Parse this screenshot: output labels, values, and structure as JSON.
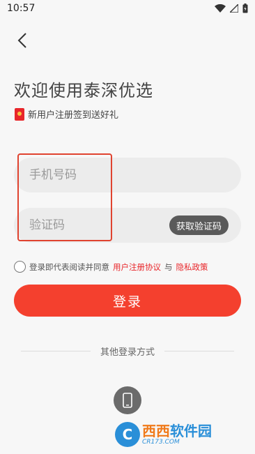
{
  "status_bar": {
    "time": "10:57"
  },
  "header": {
    "welcome_title": "欢迎使用泰深优选",
    "gift_text": "新用户注册签到送好礼"
  },
  "form": {
    "phone_placeholder": "手机号码",
    "code_placeholder": "验证码",
    "get_code_label": "获取验证码"
  },
  "agreement": {
    "prefix": "登录即代表阅读并同意",
    "user_agreement": "用户注册协议",
    "and": "与",
    "privacy_policy": "隐私政策"
  },
  "login_button_label": "登录",
  "other_login_label": "其他登录方式",
  "watermark": {
    "logo_letter": "C",
    "name_part1": "西西",
    "name_part2": "软件园",
    "site": "CR173.COM"
  },
  "colors": {
    "accent": "#f4402e",
    "link": "#e8262a",
    "highlight_box": "#e0432f"
  },
  "icons": {
    "back": "chevron-left-icon",
    "wifi": "wifi-icon",
    "signal": "signal-icon",
    "battery": "battery-icon",
    "gift": "red-packet-icon",
    "phone_login": "mobile-phone-icon"
  }
}
